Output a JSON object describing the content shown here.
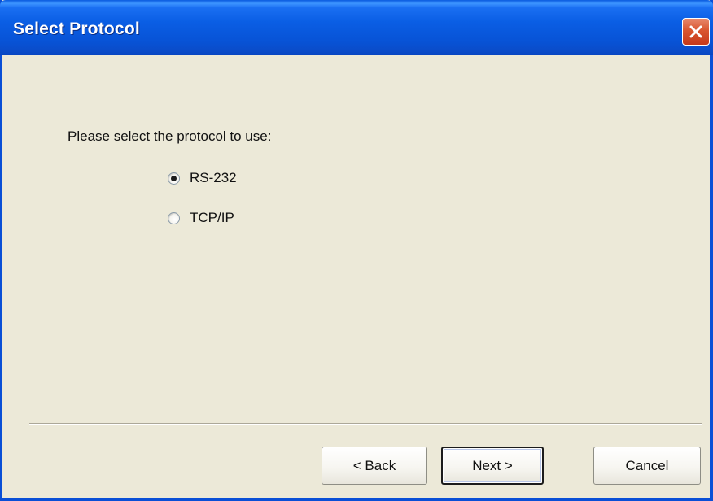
{
  "window": {
    "title": "Select Protocol"
  },
  "content": {
    "prompt": "Please select the protocol to use:",
    "options": [
      {
        "label": "RS-232",
        "selected": true
      },
      {
        "label": "TCP/IP",
        "selected": false
      }
    ]
  },
  "buttons": {
    "back": "< Back",
    "next": "Next >",
    "cancel": "Cancel"
  },
  "icons": {
    "close": "close-icon"
  },
  "colors": {
    "titlebar": "#0a5ee4",
    "close_button": "#d9552f",
    "background": "#ece9d8"
  }
}
